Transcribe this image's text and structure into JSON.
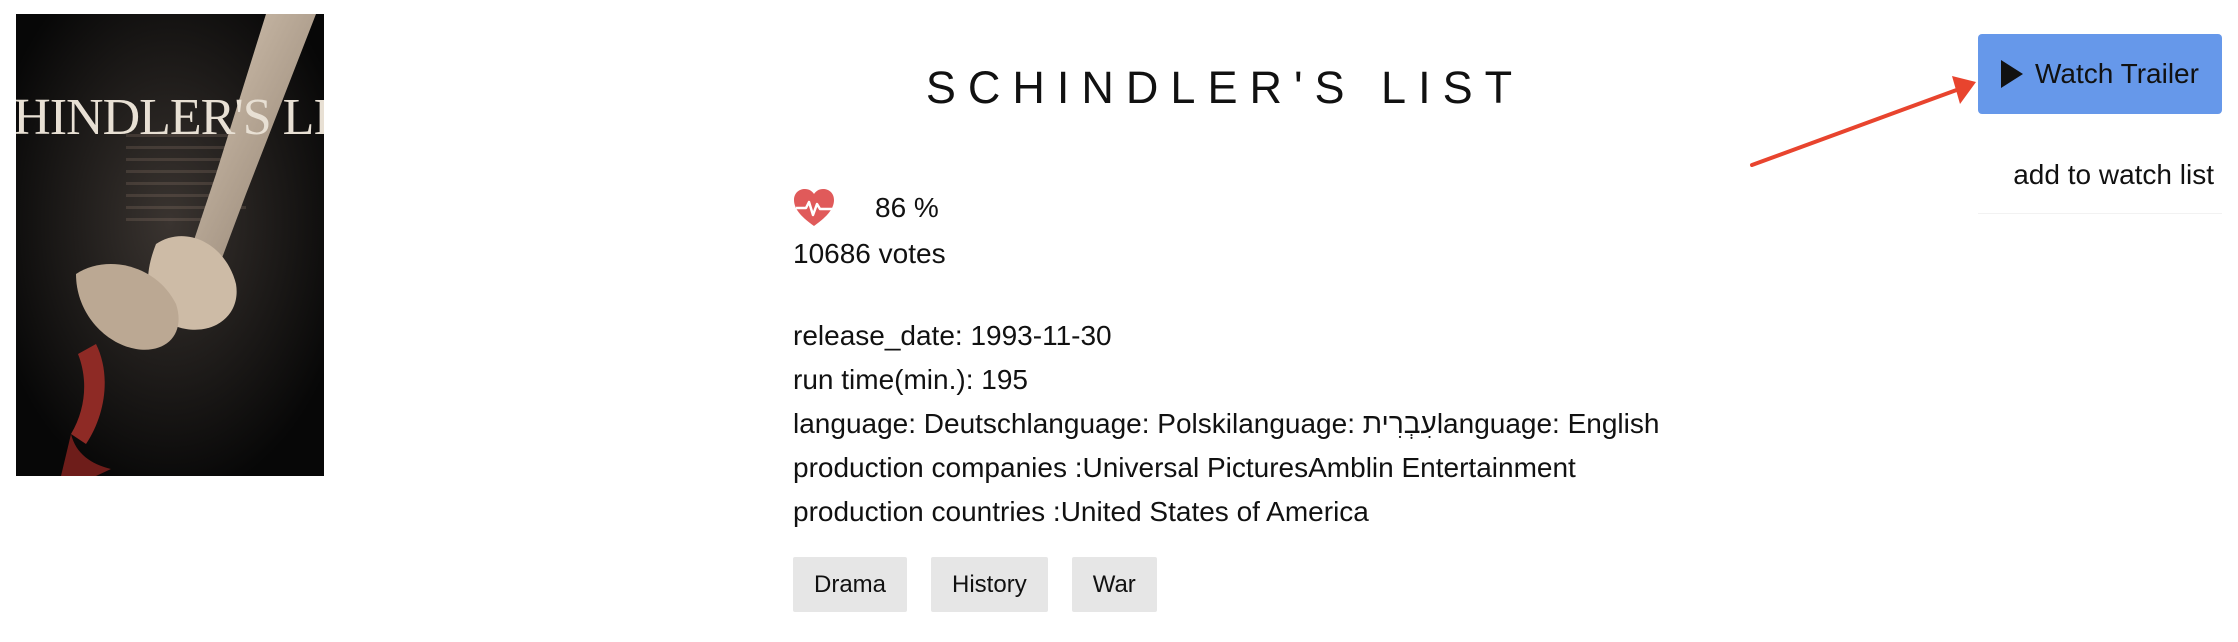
{
  "movie": {
    "title": "SCHINDLER'S LIST",
    "poster_title": "SCHINDLER'S LIST",
    "rating": "86 %",
    "votes": "10686 votes",
    "release_date": "release_date: 1993-11-30",
    "run_time": "run time(min.): 195",
    "languages": "language: Deutschlanguage: Polskilanguage: עִבְרִיתlanguage: English",
    "production_companies": "production companies :Universal PicturesAmblin Entertainment",
    "production_countries": "production countries :United States of America",
    "genres": [
      "Drama",
      "History",
      "War"
    ]
  },
  "actions": {
    "watch_trailer": "Watch Trailer",
    "add_to_watch_list": "add to watch list"
  },
  "colors": {
    "accent": "#6698ea",
    "heart": "#e05a5a",
    "annotation_arrow": "#e8442e",
    "genre_bg": "#e6e6e6"
  },
  "icons": [
    "heart-pulse-icon",
    "play-icon"
  ]
}
